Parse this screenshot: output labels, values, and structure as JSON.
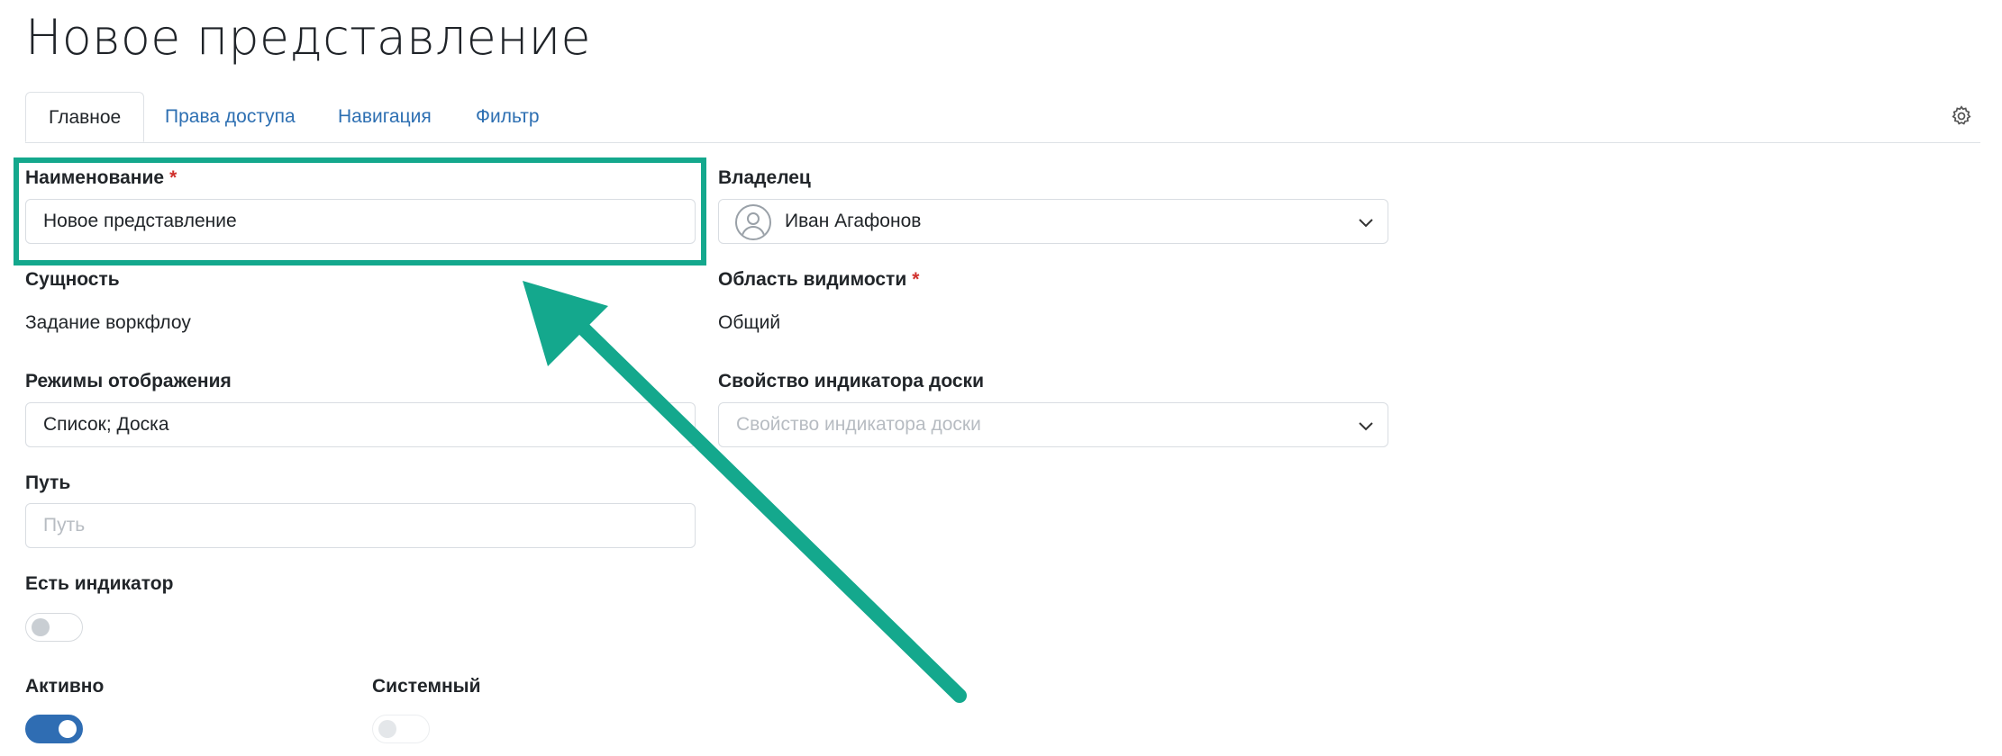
{
  "page": {
    "title": "Новое представление"
  },
  "tabs": [
    {
      "label": "Главное",
      "active": true
    },
    {
      "label": "Права доступа",
      "active": false
    },
    {
      "label": "Навигация",
      "active": false
    },
    {
      "label": "Фильтр",
      "active": false
    }
  ],
  "form": {
    "name": {
      "label": "Наименование",
      "required": "*",
      "value": "Новое представление"
    },
    "owner": {
      "label": "Владелец",
      "value": "Иван Агафонов"
    },
    "entity": {
      "label": "Сущность",
      "value": "Задание воркфлоу"
    },
    "visibility": {
      "label": "Область видимости",
      "required": "*",
      "value": "Общий"
    },
    "display_modes": {
      "label": "Режимы отображения",
      "value": "Список; Доска"
    },
    "board_indicator": {
      "label": "Свойство индикатора доски",
      "placeholder": "Свойство индикатора доски"
    },
    "path": {
      "label": "Путь",
      "placeholder": "Путь"
    },
    "has_indicator": {
      "label": "Есть индикатор",
      "on": false
    },
    "active": {
      "label": "Активно",
      "on": true
    },
    "system": {
      "label": "Системный",
      "on": false
    }
  },
  "annotation": {
    "highlight_color": "#14a88d"
  },
  "icons": {
    "settings": "gear-icon",
    "dropdown": "chevron-down-icon",
    "avatar": "user-avatar-icon"
  },
  "colors": {
    "accent": "#2f6db3",
    "link": "#2d6fb2",
    "required": "#d0312d"
  }
}
